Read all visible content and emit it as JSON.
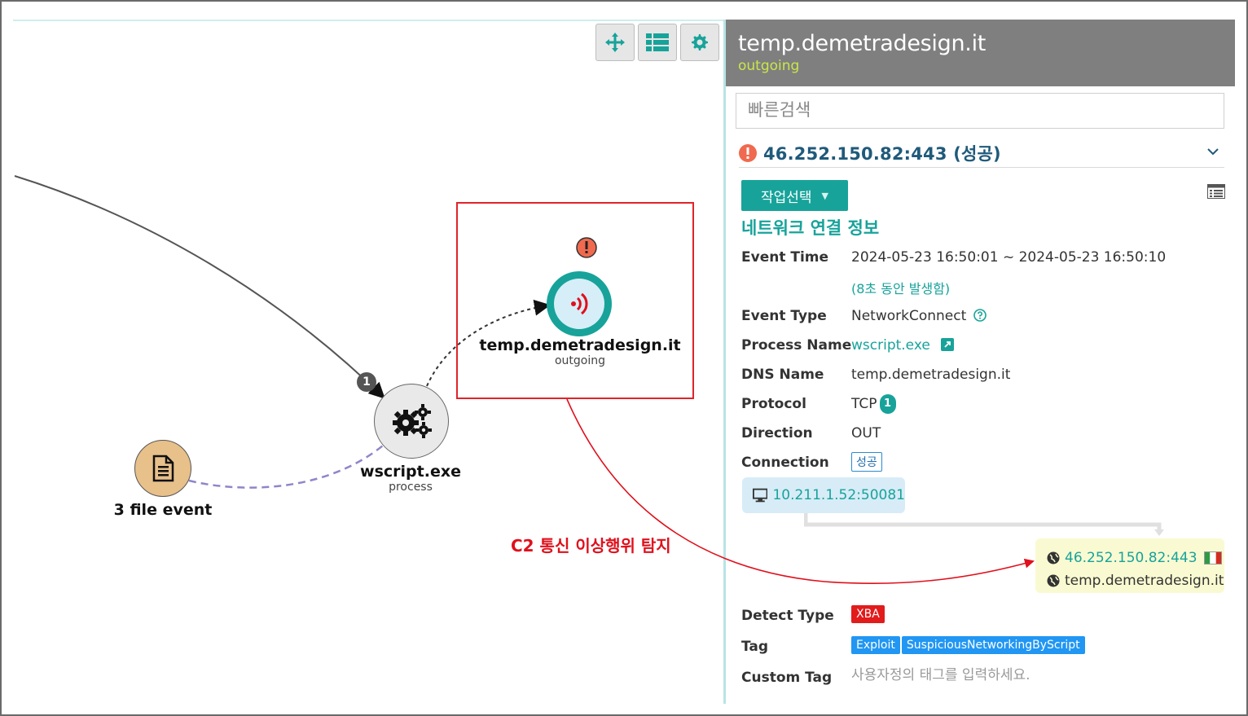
{
  "graph": {
    "toolbar": {
      "move_icon": "move-arrows-icon",
      "list_icon": "list-icon",
      "settings_icon": "gear-icon"
    },
    "nodes": {
      "domain": {
        "title": "temp.demetradesign.it",
        "subtitle": "outgoing",
        "alert_icon": "alert-icon",
        "icon": "signal-icon"
      },
      "process": {
        "title": "wscript.exe",
        "subtitle": "process",
        "icon": "gears-icon",
        "count_badge": "1"
      },
      "files": {
        "title": "3 file event",
        "icon": "document-icon"
      }
    },
    "annotation": "C2 통신 이상행위 탐지",
    "colors": {
      "highlight": "#e0242a",
      "teal": "#17a39a",
      "file_node": "#e8c08a",
      "dashed_edge": "#8f86c9"
    }
  },
  "panel": {
    "title": "temp.demetradesign.it",
    "subtitle": "outgoing",
    "search_placeholder": "빠른검색",
    "connection": {
      "title": "46.252.150.82:443 (성공)"
    },
    "action_button": "작업선택",
    "section_title": "네트워크 연결 정보",
    "fields": {
      "event_time_label": "Event Time",
      "event_time_value": "2024-05-23 16:50:01 ~ 2024-05-23 16:50:10",
      "event_time_note": "(8초 동안 발생함)",
      "event_type_label": "Event Type",
      "event_type_value": "NetworkConnect",
      "process_name_label": "Process Name",
      "process_name_value": "wscript.exe",
      "dns_name_label": "DNS Name",
      "dns_name_value": "temp.demetradesign.it",
      "protocol_label": "Protocol",
      "protocol_value": "TCP",
      "protocol_badge": "1",
      "direction_label": "Direction",
      "direction_value": "OUT",
      "connection_label": "Connection",
      "connection_value": "성공"
    },
    "source": {
      "address": "10.211.1.52:50081",
      "icon": "monitor-icon"
    },
    "destination": {
      "address": "46.252.150.82:443",
      "host": "temp.demetradesign.it",
      "icon": "globe-icon",
      "flag": "italy-flag-icon"
    },
    "detect_type_label": "Detect Type",
    "detect_type_value": "XBA",
    "tag_label": "Tag",
    "tags": [
      "Exploit",
      "SuspiciousNetworkingByScript"
    ],
    "custom_tag_label": "Custom Tag",
    "custom_tag_placeholder": "사용자정의 태그를 입력하세요."
  }
}
